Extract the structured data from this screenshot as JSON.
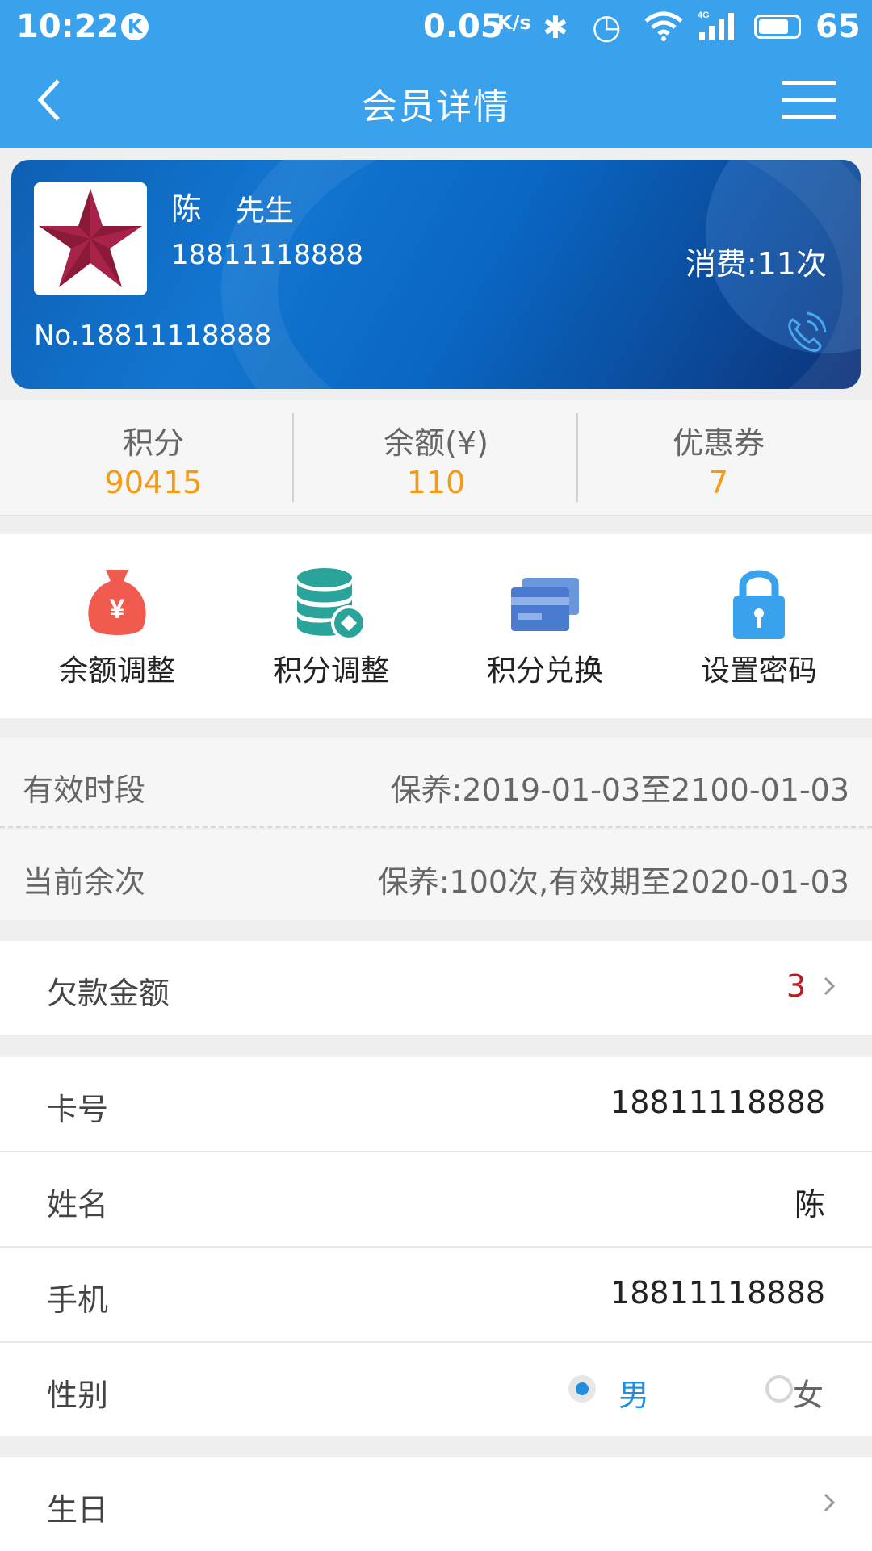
{
  "status_bar": {
    "time": "10:22",
    "k_badge": "K",
    "speed": "0.05",
    "speed_unit": "K/s",
    "battery": "65",
    "icons": [
      "bluetooth-icon",
      "alarm-icon",
      "wifi-icon",
      "signal-4g-icon",
      "battery-icon"
    ]
  },
  "navbar": {
    "title": "会员详情",
    "back_icon": "back-arrow-icon",
    "menu_icon": "hamburger-menu-icon"
  },
  "card": {
    "name": "陈",
    "salutation": "先生",
    "phone": "18811118888",
    "visits": "消费:11次",
    "card_no": "No.18811118888",
    "avatar_icon": "red-star-avatar",
    "call_icon": "phone-call-icon"
  },
  "stats": [
    {
      "label": "积分",
      "value": "90415"
    },
    {
      "label": "余额(¥)",
      "value": "110"
    },
    {
      "label": "优惠券",
      "value": "7"
    }
  ],
  "actions": [
    {
      "label": "余额调整",
      "icon": "money-bag-icon",
      "color": "#f05a4f"
    },
    {
      "label": "积分调整",
      "icon": "coin-stack-icon",
      "color": "#2aa39a"
    },
    {
      "label": "积分兑换",
      "icon": "card-icon",
      "color": "#4a7bd0"
    },
    {
      "label": "设置密码",
      "icon": "lock-icon",
      "color": "#3aa2ec"
    }
  ],
  "info": [
    {
      "label": "有效时段",
      "value": "保养:2019-01-03至2100-01-03"
    },
    {
      "label": "当前余次",
      "value": "保养:100次,有效期至2020-01-03"
    }
  ],
  "debt": {
    "label": "欠款金额",
    "value": "3"
  },
  "fields": {
    "card_no": {
      "label": "卡号",
      "value": "18811118888"
    },
    "name": {
      "label": "姓名",
      "value": "陈"
    },
    "mobile": {
      "label": "手机",
      "value": "18811118888"
    },
    "gender": {
      "label": "性别",
      "male": "男",
      "female": "女",
      "selected": "男"
    },
    "birthday": {
      "label": "生日"
    }
  },
  "colors": {
    "primary": "#3aa2ec",
    "accent_orange": "#f59a12",
    "debt_red": "#c0181e"
  }
}
